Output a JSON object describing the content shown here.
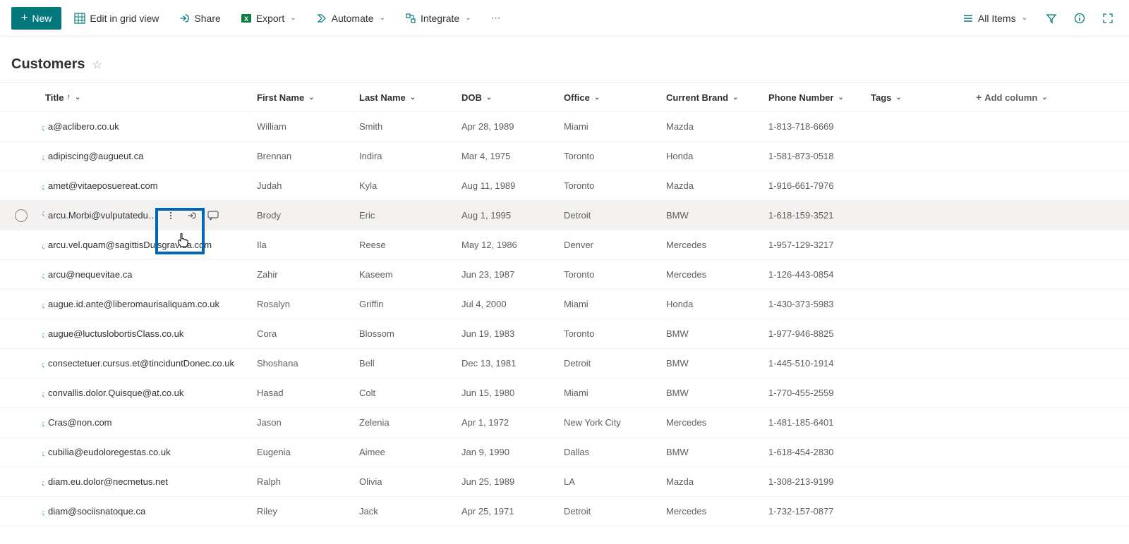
{
  "toolbar": {
    "new": "New",
    "editGrid": "Edit in grid view",
    "share": "Share",
    "export": "Export",
    "automate": "Automate",
    "integrate": "Integrate",
    "viewName": "All Items"
  },
  "page": {
    "title": "Customers"
  },
  "columns": {
    "title": "Title",
    "firstName": "First Name",
    "lastName": "Last Name",
    "dob": "DOB",
    "office": "Office",
    "brand": "Current Brand",
    "phone": "Phone Number",
    "tags": "Tags",
    "addColumn": "Add column"
  },
  "hoverRowIndex": 3,
  "rows": [
    {
      "title": "a@aclibero.co.uk",
      "first": "William",
      "last": "Smith",
      "dob": "Apr 28, 1989",
      "office": "Miami",
      "brand": "Mazda",
      "phone": "1-813-718-6669"
    },
    {
      "title": "adipiscing@augueut.ca",
      "first": "Brennan",
      "last": "Indira",
      "dob": "Mar 4, 1975",
      "office": "Toronto",
      "brand": "Honda",
      "phone": "1-581-873-0518"
    },
    {
      "title": "amet@vitaeposuereat.com",
      "first": "Judah",
      "last": "Kyla",
      "dob": "Aug 11, 1989",
      "office": "Toronto",
      "brand": "Mazda",
      "phone": "1-916-661-7976"
    },
    {
      "title": "arcu.Morbi@vulputatedu…",
      "first": "Brody",
      "last": "Eric",
      "dob": "Aug 1, 1995",
      "office": "Detroit",
      "brand": "BMW",
      "phone": "1-618-159-3521"
    },
    {
      "title": "arcu.vel.quam@sagittisDuisgravida.com",
      "first": "Ila",
      "last": "Reese",
      "dob": "May 12, 1986",
      "office": "Denver",
      "brand": "Mercedes",
      "phone": "1-957-129-3217"
    },
    {
      "title": "arcu@nequevitae.ca",
      "first": "Zahir",
      "last": "Kaseem",
      "dob": "Jun 23, 1987",
      "office": "Toronto",
      "brand": "Mercedes",
      "phone": "1-126-443-0854"
    },
    {
      "title": "augue.id.ante@liberomaurisaliquam.co.uk",
      "first": "Rosalyn",
      "last": "Griffin",
      "dob": "Jul 4, 2000",
      "office": "Miami",
      "brand": "Honda",
      "phone": "1-430-373-5983"
    },
    {
      "title": "augue@luctuslobortisClass.co.uk",
      "first": "Cora",
      "last": "Blossom",
      "dob": "Jun 19, 1983",
      "office": "Toronto",
      "brand": "BMW",
      "phone": "1-977-946-8825"
    },
    {
      "title": "consectetuer.cursus.et@tinciduntDonec.co.uk",
      "first": "Shoshana",
      "last": "Bell",
      "dob": "Dec 13, 1981",
      "office": "Detroit",
      "brand": "BMW",
      "phone": "1-445-510-1914"
    },
    {
      "title": "convallis.dolor.Quisque@at.co.uk",
      "first": "Hasad",
      "last": "Colt",
      "dob": "Jun 15, 1980",
      "office": "Miami",
      "brand": "BMW",
      "phone": "1-770-455-2559"
    },
    {
      "title": "Cras@non.com",
      "first": "Jason",
      "last": "Zelenia",
      "dob": "Apr 1, 1972",
      "office": "New York City",
      "brand": "Mercedes",
      "phone": "1-481-185-6401"
    },
    {
      "title": "cubilia@eudoloregestas.co.uk",
      "first": "Eugenia",
      "last": "Aimee",
      "dob": "Jan 9, 1990",
      "office": "Dallas",
      "brand": "BMW",
      "phone": "1-618-454-2830"
    },
    {
      "title": "diam.eu.dolor@necmetus.net",
      "first": "Ralph",
      "last": "Olivia",
      "dob": "Jun 25, 1989",
      "office": "LA",
      "brand": "Mazda",
      "phone": "1-308-213-9199"
    },
    {
      "title": "diam@sociisnatoque.ca",
      "first": "Riley",
      "last": "Jack",
      "dob": "Apr 25, 1971",
      "office": "Detroit",
      "brand": "Mercedes",
      "phone": "1-732-157-0877"
    }
  ]
}
